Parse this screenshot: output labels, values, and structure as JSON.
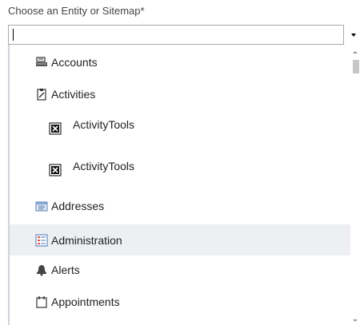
{
  "field": {
    "label": "Choose an Entity or Sitemap*",
    "value": ""
  },
  "dropdown": {
    "items": [
      {
        "label": "Accounts",
        "icon": "accounts-icon",
        "highlighted": false
      },
      {
        "label": "Activities",
        "icon": "activities-icon",
        "highlighted": false
      },
      {
        "label": "ActivityTools",
        "icon": "broken-image-icon",
        "highlighted": false
      },
      {
        "label": "ActivityTools",
        "icon": "broken-image-icon",
        "highlighted": false
      },
      {
        "label": "Addresses",
        "icon": "addresses-icon",
        "highlighted": false
      },
      {
        "label": "Administration",
        "icon": "administration-icon",
        "highlighted": true
      },
      {
        "label": "Alerts",
        "icon": "alerts-icon",
        "highlighted": false
      },
      {
        "label": "Appointments",
        "icon": "appointments-icon",
        "highlighted": false
      }
    ]
  },
  "colors": {
    "highlight_bg": "#edeff2",
    "border": "#a9a9a9",
    "text": "#222222"
  }
}
